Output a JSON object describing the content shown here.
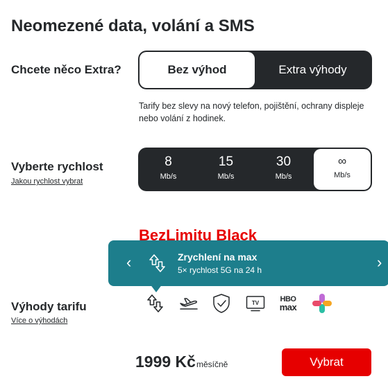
{
  "title": "Neomezené data, volání a SMS",
  "extra": {
    "label": "Chcete něco Extra?",
    "options": [
      "Bez výhod",
      "Extra výhody"
    ],
    "selected_option": "Bez výhod",
    "description": "Tarify bez slevy na nový telefon, pojištění, ochrany displeje nebo volání z hodinek."
  },
  "speed": {
    "label": "Vyberte rychlost",
    "link": "Jakou rychlost vybrat",
    "options": [
      {
        "value": "8",
        "unit": "Mb/s"
      },
      {
        "value": "15",
        "unit": "Mb/s"
      },
      {
        "value": "30",
        "unit": "Mb/s"
      },
      {
        "value": "∞",
        "unit": "Mb/s"
      }
    ],
    "selected_option": "∞"
  },
  "tariff": {
    "name": "BezLimitu Black"
  },
  "tooltip": {
    "title": "Zrychlení na max",
    "text": "5× rychlost 5G na 24 h",
    "prev_glyph": "‹",
    "next_glyph": "›",
    "icon": "speed-boost-icon"
  },
  "benefits": {
    "label": "Výhody tarifu",
    "link": "Více o výhodách",
    "icons": [
      "speed-boost-icon",
      "airplane-icon",
      "shield-check-icon",
      "tv-icon",
      "hbo-max-logo",
      "plus-logo"
    ],
    "hbo_line1": "HBO",
    "hbo_line2": "max",
    "tv_label": "TV"
  },
  "price": {
    "amount": "1999 Kč",
    "period": "měsíčně"
  },
  "cta": {
    "label": "Vybrat"
  },
  "colors": {
    "accent": "#e60000",
    "dark": "#25282b",
    "tooltip": "#1d7e8c"
  }
}
